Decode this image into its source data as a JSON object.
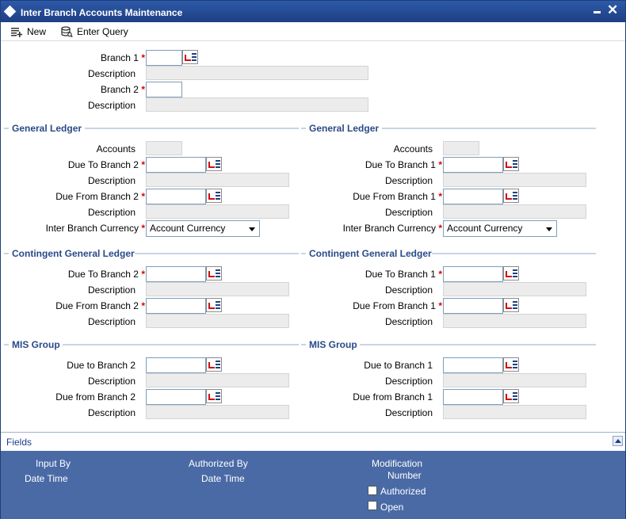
{
  "window": {
    "title": "Inter Branch Accounts Maintenance"
  },
  "toolbar": {
    "new_label": "New",
    "enter_query_label": "Enter Query"
  },
  "header": {
    "branch1_label": "Branch 1",
    "branch1_value": "",
    "description1_label": "Description",
    "branch2_label": "Branch 2",
    "branch2_value": "",
    "description2_label": "Description"
  },
  "left": {
    "gl_title": "General Ledger",
    "accounts_label": "Accounts",
    "due_to_label": "Due To Branch 2",
    "desc_label": "Description",
    "due_from_label": "Due From Branch 2",
    "currency_label": "Inter Branch Currency",
    "currency_value": "Account Currency",
    "cgl_title": "Contingent General Ledger",
    "mis_title": "MIS Group",
    "mis_due_to_label": "Due to Branch 2",
    "mis_due_from_label": "Due from Branch 2"
  },
  "right": {
    "gl_title": "General Ledger",
    "accounts_label": "Accounts",
    "due_to_label": "Due To Branch 1",
    "desc_label": "Description",
    "due_from_label": "Due From Branch 1",
    "currency_label": "Inter Branch Currency",
    "currency_value": "Account Currency",
    "cgl_title": "Contingent General Ledger",
    "mis_title": "MIS Group",
    "mis_due_to_label": "Due to Branch 1",
    "mis_due_from_label": "Due from Branch 1"
  },
  "required_mark": "*",
  "fields_bar": {
    "label": "Fields"
  },
  "audit": {
    "input_by": "Input By",
    "date_time_1": "Date Time",
    "authorized_by": "Authorized By",
    "date_time_2": "Date Time",
    "modification": "Modification",
    "number": "Number",
    "authorized": "Authorized",
    "open": "Open"
  },
  "colors": {
    "title_bar": "#1d3f84",
    "footer": "#4a6aa6",
    "section_title": "#2a4a88",
    "required": "#dd0000"
  }
}
